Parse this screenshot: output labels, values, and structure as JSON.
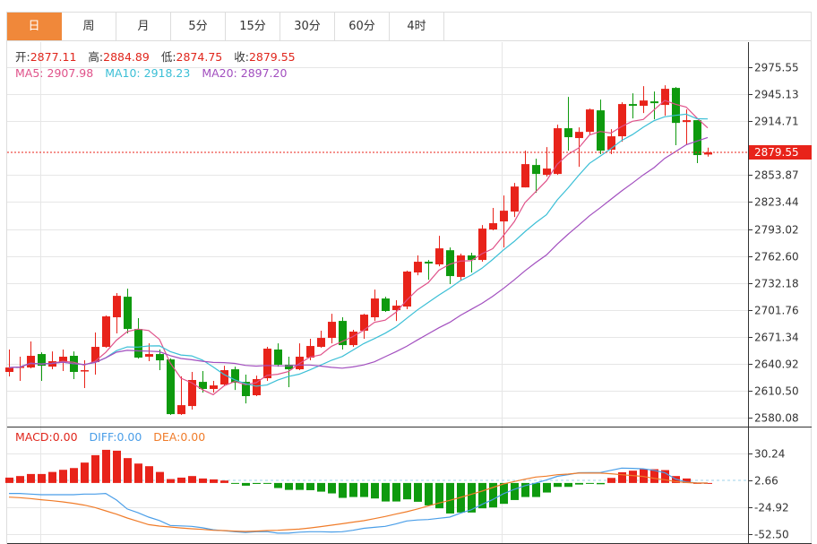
{
  "tabs": [
    {
      "label": "日",
      "active": true
    },
    {
      "label": "周"
    },
    {
      "label": "月"
    },
    {
      "label": "5分"
    },
    {
      "label": "15分"
    },
    {
      "label": "30分"
    },
    {
      "label": "60分"
    },
    {
      "label": "4时"
    }
  ],
  "ohlc_info": {
    "open_label": "开:",
    "open": "2877.11",
    "high_label": "高:",
    "high": "2884.89",
    "low_label": "低:",
    "low": "2874.75",
    "close_label": "收:",
    "close": "2879.55"
  },
  "ma_info": {
    "ma5_label": "MA5:",
    "ma5": "2907.98",
    "ma10_label": "MA10:",
    "ma10": "2918.23",
    "ma20_label": "MA20:",
    "ma20": "2897.20"
  },
  "macd_info": {
    "macd_label": "MACD:",
    "macd": "0.00",
    "diff_label": "DIFF:",
    "diff": "0.00",
    "dea_label": "DEA:",
    "dea": "0.00"
  },
  "colors": {
    "accent": "#f0883a",
    "up": "#e8231a",
    "down": "#0e9a0e",
    "ma5": "#e0528a",
    "ma10": "#3bbfd6",
    "ma20": "#a24fbf",
    "diff": "#4a9ee8",
    "dea": "#f07c2a"
  },
  "chart_data": [
    {
      "type": "candlestick",
      "ylim": [
        2570,
        3004
      ],
      "y_ticks": [
        "2975.55",
        "2945.13",
        "2914.71",
        "2853.87",
        "2823.44",
        "2793.02",
        "2762.60",
        "2732.18",
        "2701.76",
        "2671.34",
        "2640.92",
        "2610.50",
        "2580.08"
      ],
      "last_price_label": "2879.55",
      "last_price": 2879.55,
      "grid": true,
      "moving_averages": [
        5,
        10,
        20
      ],
      "ohlc": [
        [
          2631.7,
          2636.7,
          2657.0,
          2626.6
        ],
        [
          2636.7,
          2637.7,
          2648.9,
          2621.6
        ],
        [
          2636.7,
          2649.9,
          2666.1,
          2635.7
        ],
        [
          2651.9,
          2638.7,
          2653.9,
          2621.6
        ],
        [
          2637.7,
          2643.8,
          2654.9,
          2634.7
        ],
        [
          2642.8,
          2648.9,
          2657.0,
          2632.7
        ],
        [
          2649.9,
          2631.7,
          2654.9,
          2623.6
        ],
        [
          2632.7,
          2633.7,
          2644.8,
          2613.5
        ],
        [
          2642.8,
          2660.0,
          2676.2,
          2628.7
        ],
        [
          2660.0,
          2694.4,
          2695.4,
          2659.0
        ],
        [
          2693.4,
          2717.6,
          2720.7,
          2675.2
        ],
        [
          2716.6,
          2680.2,
          2725.7,
          2675.2
        ],
        [
          2680.2,
          2647.9,
          2692.4,
          2646.8
        ],
        [
          2648.9,
          2651.9,
          2664.0,
          2643.8
        ],
        [
          2651.9,
          2644.8,
          2657.0,
          2633.7
        ],
        [
          2645.8,
          2584.1,
          2647.0,
          2583.1
        ],
        [
          2584.1,
          2594.2,
          2626.6,
          2583.1
        ],
        [
          2593.2,
          2622.6,
          2631.7,
          2589.2
        ],
        [
          2620.5,
          2612.5,
          2632.7,
          2608.4
        ],
        [
          2612.5,
          2616.5,
          2621.6,
          2608.4
        ],
        [
          2617.5,
          2633.7,
          2638.7,
          2616.5
        ],
        [
          2634.7,
          2619.5,
          2637.7,
          2611.4
        ],
        [
          2620.5,
          2604.4,
          2628.7,
          2596.2
        ],
        [
          2605.4,
          2623.6,
          2627.6,
          2604.4
        ],
        [
          2624.6,
          2658.0,
          2660.0,
          2621.6
        ],
        [
          2657.0,
          2639.8,
          2664.0,
          2637.7
        ],
        [
          2639.8,
          2634.7,
          2648.9,
          2614.5
        ],
        [
          2634.7,
          2648.9,
          2664.0,
          2633.7
        ],
        [
          2647.9,
          2661.0,
          2669.1,
          2644.8
        ],
        [
          2660.0,
          2670.1,
          2678.2,
          2659.0
        ],
        [
          2670.1,
          2688.3,
          2697.4,
          2664.0
        ],
        [
          2689.3,
          2662.0,
          2693.4,
          2657.0
        ],
        [
          2662.0,
          2677.2,
          2679.2,
          2660.0
        ],
        [
          2678.2,
          2696.4,
          2697.4,
          2669.1
        ],
        [
          2693.4,
          2714.6,
          2724.7,
          2689.3
        ],
        [
          2714.6,
          2700.5,
          2716.6,
          2699.5
        ],
        [
          2701.5,
          2706.5,
          2712.6,
          2689.3
        ],
        [
          2705.5,
          2745.0,
          2746.0,
          2702.5
        ],
        [
          2744.0,
          2756.1,
          2763.2,
          2740.9
        ],
        [
          2756.1,
          2754.1,
          2758.1,
          2735.8
        ],
        [
          2753.1,
          2771.2,
          2785.4,
          2751.0
        ],
        [
          2769.1,
          2739.9,
          2772.2,
          2730.8
        ],
        [
          2738.9,
          2763.2,
          2765.2,
          2734.9
        ],
        [
          2763.2,
          2758.1,
          2766.2,
          2744.0
        ],
        [
          2758.1,
          2793.5,
          2797.5,
          2756.1
        ],
        [
          2792.5,
          2799.6,
          2816.8,
          2791.5
        ],
        [
          2801.6,
          2813.7,
          2830.9,
          2772.2
        ],
        [
          2812.7,
          2841.0,
          2845.1,
          2806.6
        ],
        [
          2840.0,
          2866.3,
          2881.5,
          2840.0
        ],
        [
          2865.3,
          2855.2,
          2872.4,
          2833.9
        ],
        [
          2854.2,
          2861.3,
          2885.5,
          2852.2
        ],
        [
          2855.2,
          2906.8,
          2910.8,
          2854.2
        ],
        [
          2906.8,
          2896.7,
          2942.2,
          2881.5
        ],
        [
          2895.7,
          2902.7,
          2907.8,
          2863.3
        ],
        [
          2902.7,
          2928.0,
          2929.0,
          2899.7
        ],
        [
          2927.0,
          2881.5,
          2939.1,
          2877.5
        ],
        [
          2882.5,
          2897.7,
          2905.8,
          2877.5
        ],
        [
          2897.7,
          2934.1,
          2936.1,
          2891.6
        ],
        [
          2934.1,
          2932.1,
          2946.2,
          2917.9
        ],
        [
          2932.1,
          2938.1,
          2954.3,
          2924.0
        ],
        [
          2937.1,
          2935.1,
          2948.2,
          2916.9
        ],
        [
          2933.1,
          2951.3,
          2955.3,
          2920.9
        ],
        [
          2952.3,
          2912.8,
          2953.3,
          2887.6
        ],
        [
          2913.8,
          2915.9,
          2928.0,
          2887.6
        ],
        [
          2915.9,
          2876.5,
          2915.9,
          2867.4
        ],
        [
          2877.11,
          2879.55,
          2884.89,
          2874.75
        ]
      ]
    },
    {
      "type": "bar+line",
      "ylim": [
        -62.6,
        56.9
      ],
      "y_ticks": [
        "30.24",
        "2.66",
        "-24.92",
        "-52.50"
      ],
      "current_value": 2.66,
      "macd": [
        5.5,
        7.1,
        9.2,
        9.2,
        11.3,
        13.5,
        15.3,
        20.9,
        28.5,
        34.0,
        33.1,
        25.5,
        19.9,
        17.2,
        11.3,
        4.0,
        5.5,
        7.1,
        4.6,
        3.7,
        2.5,
        -0.8,
        -2.8,
        -1.0,
        -0.8,
        -5.2,
        -7.1,
        -7.1,
        -7.4,
        -8.9,
        -10.7,
        -15.3,
        -14.4,
        -14.4,
        -15.9,
        -19.0,
        -19.0,
        -16.8,
        -19.3,
        -23.0,
        -26.0,
        -31.3,
        -30.3,
        -30.3,
        -26.0,
        -25.1,
        -21.4,
        -17.5,
        -14.4,
        -14.4,
        -9.8,
        -4.0,
        -4.0,
        -1.6,
        -0.2,
        -1.3,
        5.2,
        11.0,
        12.6,
        14.1,
        14.1,
        13.2,
        7.1,
        4.6,
        0.0,
        0.0
      ],
      "diff": [
        -10.8,
        -10.8,
        -11.4,
        -12.0,
        -12.0,
        -12.0,
        -12.0,
        -11.4,
        -11.4,
        -10.8,
        -17.5,
        -26.7,
        -30.5,
        -35.0,
        -38.5,
        -43.6,
        -44.0,
        -44.5,
        -46.0,
        -48.0,
        -49.0,
        -50.0,
        -50.7,
        -50.0,
        -49.9,
        -51.5,
        -51.5,
        -50.5,
        -50.0,
        -50.0,
        -50.3,
        -50.0,
        -48.5,
        -46.5,
        -45.5,
        -44.5,
        -42.0,
        -39.0,
        -38.0,
        -37.5,
        -36.2,
        -35.0,
        -31.0,
        -27.5,
        -22.0,
        -17.0,
        -11.0,
        -6.5,
        -2.8,
        -0.2,
        3.0,
        6.8,
        8.5,
        10.5,
        10.7,
        10.7,
        13.0,
        15.3,
        15.0,
        14.5,
        13.0,
        10.5,
        4.0,
        1.0,
        0.0,
        -0.1
      ],
      "dea": [
        -14.5,
        -15.1,
        -16.0,
        -17.2,
        -18.2,
        -19.4,
        -20.9,
        -22.7,
        -25.2,
        -28.6,
        -32.0,
        -35.9,
        -39.3,
        -42.7,
        -44.2,
        -45.1,
        -46.1,
        -47.0,
        -47.6,
        -48.5,
        -48.8,
        -49.4,
        -49.7,
        -49.4,
        -48.8,
        -48.5,
        -47.9,
        -47.3,
        -46.1,
        -44.8,
        -43.3,
        -41.8,
        -40.2,
        -38.7,
        -36.6,
        -34.4,
        -31.9,
        -29.5,
        -26.7,
        -23.6,
        -20.6,
        -17.8,
        -14.8,
        -11.7,
        -8.4,
        -4.7,
        -1.0,
        1.5,
        3.9,
        6.1,
        7.0,
        8.5,
        9.1,
        10.1,
        10.1,
        10.1,
        9.5,
        8.5,
        7.6,
        6.7,
        4.8,
        3.3,
        1.5,
        0.5,
        -0.1,
        -0.1
      ]
    }
  ]
}
